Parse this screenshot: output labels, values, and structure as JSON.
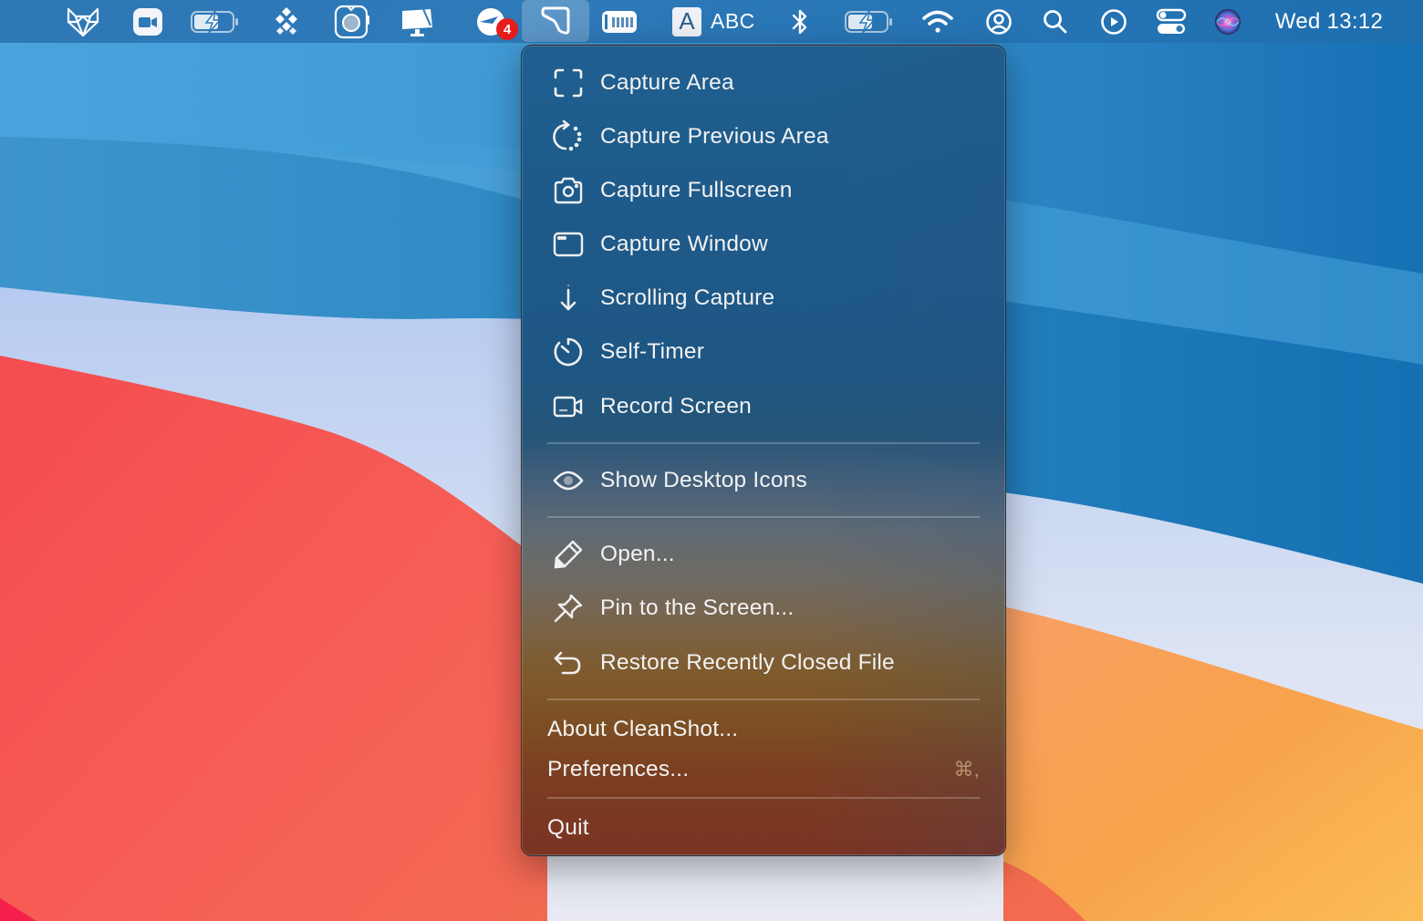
{
  "menubar": {
    "items": [
      {
        "id": "gitlab",
        "icon": "fox-logo-icon"
      },
      {
        "id": "zoom",
        "icon": "video-camera-icon"
      },
      {
        "id": "battery-app",
        "icon": "battery-charging-icon"
      },
      {
        "id": "dropbox",
        "icon": "dropbox-icon"
      },
      {
        "id": "screenshot-app",
        "icon": "camera-lens-icon"
      },
      {
        "id": "sidecar",
        "icon": "display-icon"
      },
      {
        "id": "notifications-app",
        "icon": "send-icon",
        "badge": "4"
      },
      {
        "id": "cleanshot",
        "icon": "cleanshot-icon",
        "active": true
      },
      {
        "id": "memory",
        "icon": "memory-icon"
      },
      {
        "id": "input-source",
        "icon": "input-source-icon",
        "glyph": "A",
        "label": "ABC"
      },
      {
        "id": "bluetooth",
        "icon": "bluetooth-icon"
      },
      {
        "id": "battery",
        "icon": "battery-charging-icon"
      },
      {
        "id": "wifi",
        "icon": "wifi-icon"
      },
      {
        "id": "user",
        "icon": "user-circle-icon"
      },
      {
        "id": "spotlight",
        "icon": "search-icon"
      },
      {
        "id": "media",
        "icon": "play-circle-icon"
      },
      {
        "id": "control-center",
        "icon": "toggles-icon"
      },
      {
        "id": "siri",
        "icon": "siri-icon"
      }
    ],
    "clock": "Wed 13:12"
  },
  "menu": {
    "app_name": "CleanShot",
    "groups": [
      [
        {
          "label": "Capture Area",
          "icon": "capture-area-icon"
        },
        {
          "label": "Capture Previous Area",
          "icon": "capture-previous-area-icon"
        },
        {
          "label": "Capture Fullscreen",
          "icon": "camera-icon"
        },
        {
          "label": "Capture Window",
          "icon": "window-icon"
        },
        {
          "label": "Scrolling Capture",
          "icon": "arrow-down-icon"
        },
        {
          "label": "Self-Timer",
          "icon": "timer-icon"
        },
        {
          "label": "Record Screen",
          "icon": "video-record-icon"
        }
      ],
      [
        {
          "label": "Show Desktop Icons",
          "icon": "eye-icon"
        }
      ],
      [
        {
          "label": "Open...",
          "icon": "pencil-icon"
        },
        {
          "label": "Pin to the Screen...",
          "icon": "pin-icon"
        },
        {
          "label": "Restore Recently Closed File",
          "icon": "undo-arrow-icon"
        }
      ],
      [
        {
          "label": "About CleanShot..."
        },
        {
          "label": "Preferences...",
          "shortcut": "⌘,"
        }
      ],
      [
        {
          "label": "Quit"
        }
      ]
    ]
  }
}
